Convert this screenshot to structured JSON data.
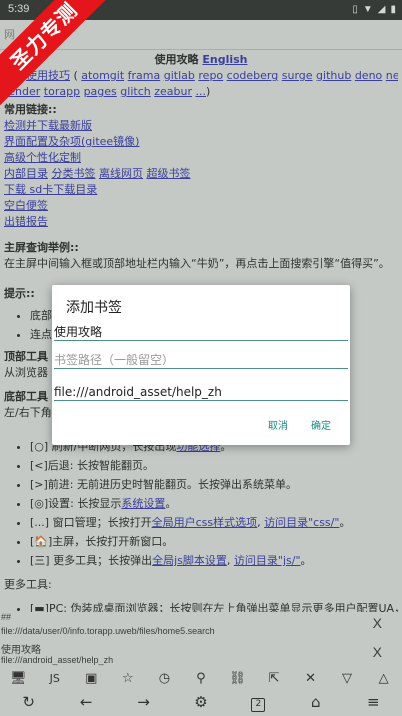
{
  "status": {
    "time": "5:39",
    "icons": [
      "vibrate-icon",
      "wifi-icon",
      "signal-icon",
      "battery-icon"
    ]
  },
  "ribbon": "圣力专测",
  "address": "网",
  "content": {
    "title": "使用攻略",
    "title_link": "English",
    "line1_a": "使用技巧",
    "line1_b": "(",
    "line1_links": [
      "atomgit",
      "frama",
      "gitlab",
      "repo",
      "codeberg",
      "surge",
      "github",
      "deno",
      "netlify",
      "kinsta"
    ],
    "line2_links": [
      "render",
      "torapp",
      "pages",
      "glitch",
      "zeabur",
      "..."
    ],
    "line2_end": ")",
    "links_header": "常用链接::",
    "link_update": "检测并下载最新版",
    "link_ui": "界面配置及杂项",
    "link_gitee": "(gitee镜像)",
    "link_adv": "高级个性化定制",
    "links_row1": [
      "内部目录",
      "分类书签",
      "离线网页",
      "超级书签"
    ],
    "link_download": "下载 sd卡下载目录",
    "link_blank": "空白便签",
    "link_report": "出错报告",
    "home_search_title": "主屏查询举例::",
    "home_search_text": "在主屏中间输入框或顶部地址栏内输入“牛奶”，再点击上面搜索引擎“值得买”。",
    "tips_title": "提示::",
    "tips_item1": "底部",
    "tips_item2": "连点",
    "top_tools": "顶部工具",
    "from_browser": "从浏览器",
    "bottom_tools": "底部工具",
    "left_right": "左/右下角",
    "list": [
      "[○] 刷新/中断网页，长按出现",
      "[<]后退: 长按智能翻页。",
      "[>]前进: 无前进历史时智能翻页。长按弹出系统菜单。",
      "[◎]设置: 长按显示",
      "[...] 窗口管理；长按打开",
      "[🏠]主屏，长按打开新窗口。",
      "[三] 更多工具；长按弹出"
    ],
    "list_link_refresh": "功能选择",
    "list_link_settings": "系统设置",
    "list_link_css": "全局用户css样式选项",
    "list_link_cssdir": "访问目录\"css/\"",
    "list_link_js": "全局js脚本设置",
    "list_link_jsdir": "访问目录\"js/\"",
    "more_tools": "更多工具:",
    "pc_item": "[▬]PC: 伪装成桌面浏览器；长按则在左上角弹出菜单显示更多用户配置UA，"
  },
  "dialog": {
    "title": "添加书签",
    "name_value": "使用攻略",
    "path_placeholder": "书签路径（一般留空）",
    "url_value": "file:///android_asset/help_zh",
    "cancel": "取消",
    "ok": "确定"
  },
  "bottom": {
    "hash": "##",
    "path1": "file:///data/user/0/info.torapp.uweb/files/home5.search",
    "page_title": "使用攻略",
    "path2": "file:///android_asset/help_zh",
    "close": "X",
    "tab_count": "2",
    "toolbar1": [
      "PC",
      "JS",
      "图",
      "☆",
      "⏱",
      "🔍",
      "🔗",
      "↗",
      "✕",
      "▽",
      "▲"
    ],
    "toolbar2": [
      "↻",
      "←",
      "→",
      "⚙",
      "2",
      "⌂",
      "≡"
    ]
  }
}
